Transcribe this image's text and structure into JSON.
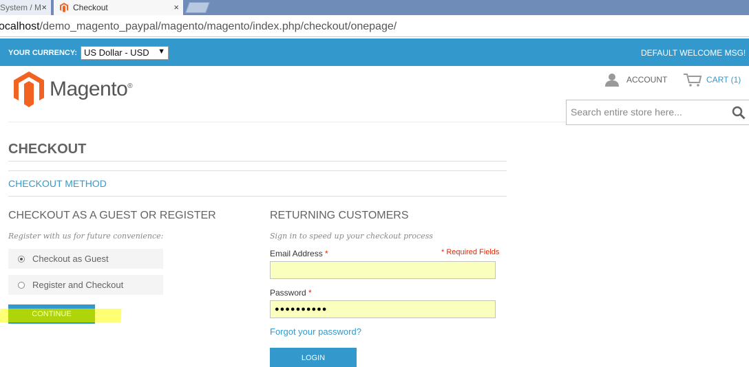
{
  "browser": {
    "tabs": [
      {
        "label": "System / M",
        "close": "×"
      },
      {
        "label": "Checkout",
        "close": "×"
      }
    ],
    "url_prefix": "ocalhost",
    "url_path": "/demo_magento_paypal/magento/magento/index.php/checkout/onepage/"
  },
  "topbar": {
    "currency_label": "YOUR CURRENCY:",
    "currency_value": "US Dollar - USD",
    "welcome": "DEFAULT WELCOME MSG!"
  },
  "header": {
    "logo_text": "Magento",
    "account_label": "ACCOUNT",
    "cart_label": "CART (1)",
    "search_placeholder": "Search entire store here..."
  },
  "main": {
    "page_title": "CHECKOUT",
    "step_title": "CHECKOUT METHOD",
    "guest": {
      "title": "CHECKOUT AS A GUEST OR REGISTER",
      "subtitle": "Register with us for future convenience:",
      "options": [
        {
          "label": "Checkout as Guest",
          "selected": true
        },
        {
          "label": "Register and Checkout",
          "selected": false
        }
      ],
      "continue_label": "CONTINUE"
    },
    "returning": {
      "title": "RETURNING CUSTOMERS",
      "subtitle": "Sign in to speed up your checkout process",
      "required_note": "* Required Fields",
      "email_label": "Email Address",
      "email_value": "",
      "password_label": "Password",
      "password_value": "●●●●●●●●●●",
      "forgot_label": "Forgot your password?",
      "login_label": "LOGIN"
    }
  },
  "colors": {
    "accent": "#3399cc",
    "required": "#df280a",
    "autofill": "#faffbd",
    "highlight": "#ffff00"
  }
}
